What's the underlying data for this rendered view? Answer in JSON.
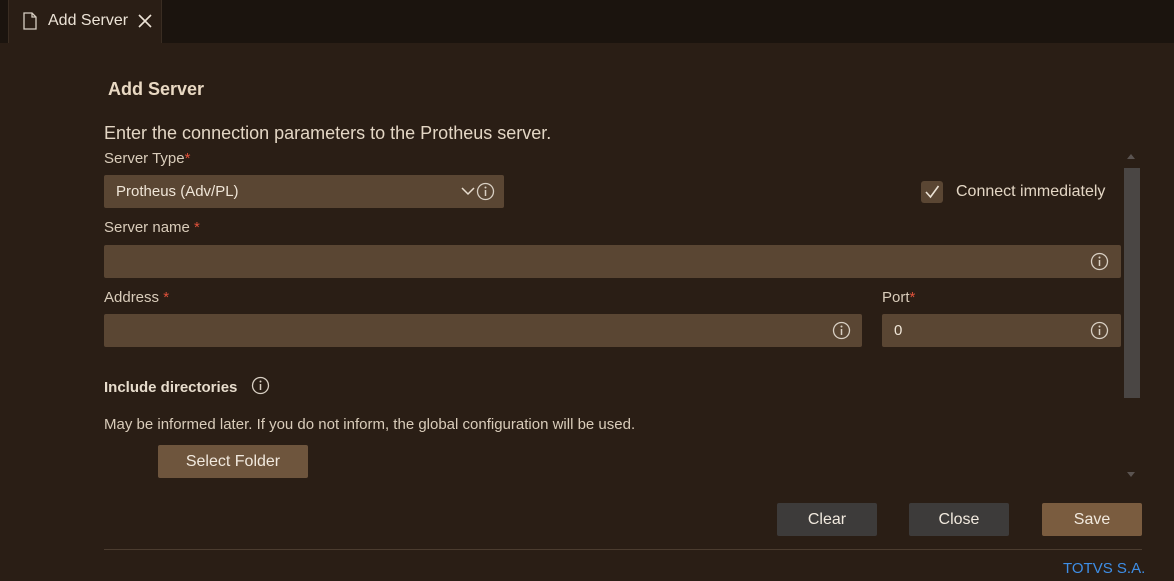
{
  "tab": {
    "label": "Add Server"
  },
  "page": {
    "title": "Add Server",
    "intro": "Enter the connection parameters to the Protheus server."
  },
  "form": {
    "server_type_label": "Server Type",
    "server_type_value": "Protheus (Adv/PL)",
    "server_name_label": "Server name ",
    "server_name_value": "",
    "address_label": "Address ",
    "address_value": "",
    "port_label": "Port",
    "port_value": "0",
    "required_mark": "*",
    "connect_immediately_label": "Connect immediately",
    "connect_immediately_checked": true
  },
  "include_directories": {
    "title": "Include directories",
    "note": "May be informed later. If you do not inform, the global configuration will be used.",
    "select_folder_label": "Select Folder"
  },
  "actions": {
    "clear_label": "Clear",
    "close_label": "Close",
    "save_label": "Save"
  },
  "footer": {
    "text": "TOTVS S.A."
  },
  "colors": {
    "background": "#2a1e15",
    "input_bg": "#5a4633",
    "accent_button": "#7a5c3f",
    "required": "#e0523b",
    "link": "#3e8ee6"
  },
  "icons": [
    "file-icon",
    "close-icon",
    "chevron-down-icon",
    "info-icon",
    "checkmark-icon"
  ]
}
